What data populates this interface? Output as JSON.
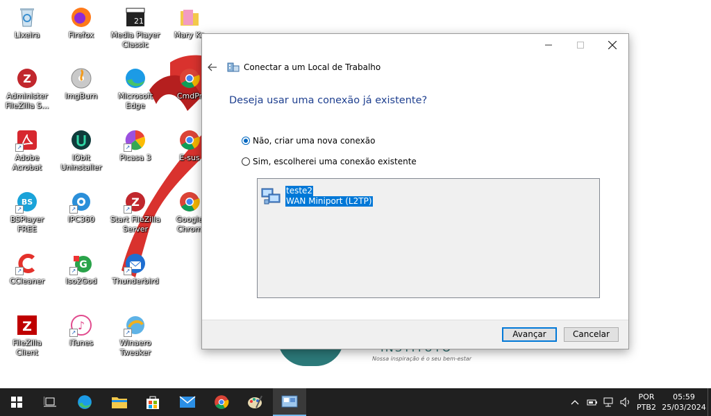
{
  "desktop": {
    "icons": [
      {
        "label": "Lixeira"
      },
      {
        "label": "Firefox"
      },
      {
        "label": "Media Player Classic"
      },
      {
        "label": "Mary Ka"
      },
      {
        "label": "Administer FileZilla S..."
      },
      {
        "label": "ImgBurn"
      },
      {
        "label": "Microsoft Edge"
      },
      {
        "label": "CmdPr"
      },
      {
        "label": "Adobe Acrobat"
      },
      {
        "label": "IObit Uninstaller"
      },
      {
        "label": "Picasa 3"
      },
      {
        "label": "E-sus"
      },
      {
        "label": "BSPlayer FREE"
      },
      {
        "label": "IPC360"
      },
      {
        "label": "Start FileZilla Server"
      },
      {
        "label": "Google Chrom"
      },
      {
        "label": "CCleaner"
      },
      {
        "label": "Iso2God"
      },
      {
        "label": "Thunderbird"
      },
      {
        "label": "FileZilla Client"
      },
      {
        "label": "iTunes"
      },
      {
        "label": "Winaero Tweaker"
      }
    ],
    "wallpaper_text": "INSTITUTO",
    "wallpaper_sub": "Nossa inspiração é o seu bem-estar"
  },
  "dialog": {
    "title": "Conectar a um Local de Trabalho",
    "heading": "Deseja usar uma conexão já existente?",
    "options": [
      {
        "label": "Não, criar uma nova conexão",
        "selected": true
      },
      {
        "label": "Sim, escolherei uma conexão existente",
        "selected": false
      }
    ],
    "connection": {
      "line1": "teste2",
      "line2": "WAN Miniport (L2TP)"
    },
    "next_label": "Avançar",
    "cancel_label": "Cancelar"
  },
  "taskbar": {
    "language": "POR",
    "layout": "PTB2",
    "time": "05:59",
    "date": "25/03/2024"
  },
  "colors": {
    "accent": "#0078d7",
    "heading": "#1e3f8f",
    "taskbar": "#202020"
  }
}
